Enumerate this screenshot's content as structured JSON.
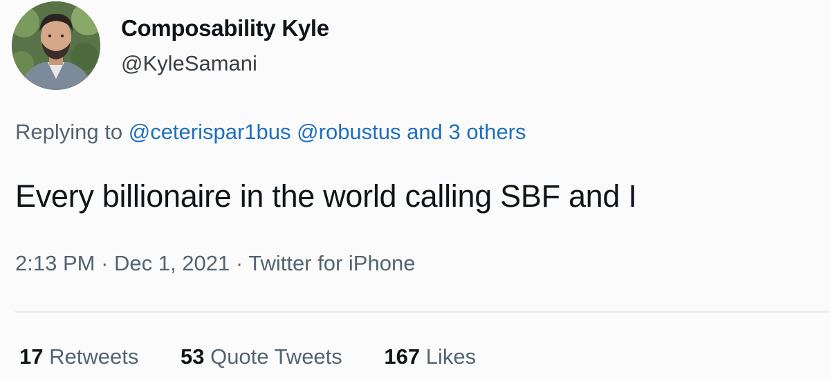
{
  "author": {
    "display_name": "Composability Kyle",
    "handle": "@KyleSamani"
  },
  "reply": {
    "prefix": "Replying to",
    "mention_1": "@ceterispar1bus",
    "mention_2": "@robustus",
    "others": "and 3 others"
  },
  "tweet": {
    "text": "Every billionaire in the world calling SBF and I"
  },
  "meta": {
    "time": "2:13 PM",
    "date": "Dec 1, 2021",
    "source": "Twitter for iPhone",
    "separator": "·"
  },
  "stats": {
    "retweets_count": "17",
    "retweets_label": "Retweets",
    "quotes_count": "53",
    "quotes_label": "Quote Tweets",
    "likes_count": "167",
    "likes_label": "Likes"
  },
  "colors": {
    "link": "#1d6fc0",
    "secondary_text": "#536471",
    "primary_text": "#0f1419"
  }
}
